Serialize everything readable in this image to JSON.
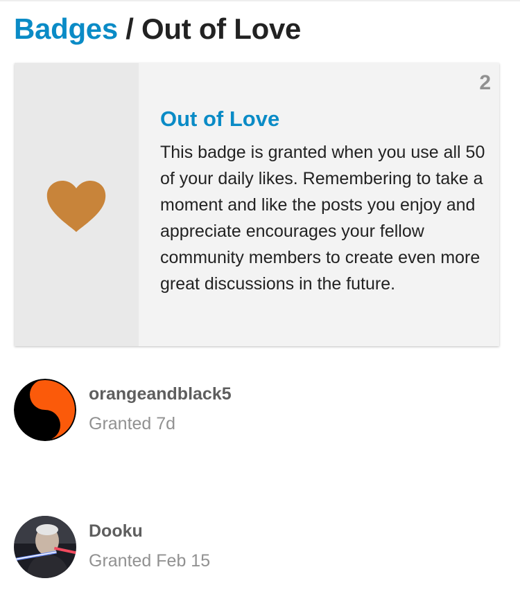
{
  "breadcrumb": {
    "parent_label": "Badges",
    "separator": "/",
    "current_label": "Out of Love"
  },
  "badge": {
    "name": "Out of Love",
    "grant_count": "2",
    "icon": "heart-icon",
    "icon_color": "#c8843a",
    "description": "This badge is granted when you use all 50 of your daily likes. Remembering to take a moment and like the posts you enjoy and appreciate encourages your fellow community members to create even more great discussions in the future."
  },
  "grantees": [
    {
      "username": "orangeandblack5",
      "granted": "Granted 7d",
      "avatar": "yin-yang-avatar"
    },
    {
      "username": "Dooku",
      "granted": "Granted Feb 15",
      "avatar": "photo-avatar"
    }
  ],
  "colors": {
    "link": "#0a8bc6",
    "card_bg": "#f3f3f3",
    "icon_col_bg": "#e9e9e9",
    "muted": "#919191",
    "username": "#5e5e5e"
  }
}
